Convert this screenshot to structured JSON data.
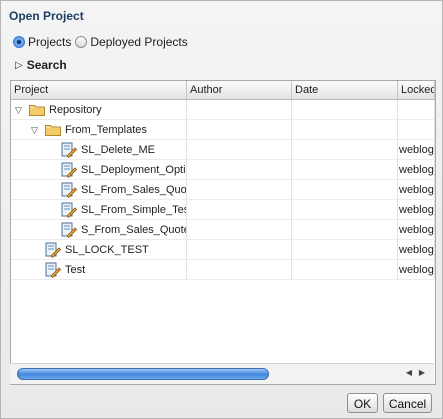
{
  "dialog": {
    "title": "Open Project"
  },
  "mode": {
    "options": [
      "Projects",
      "Deployed Projects"
    ],
    "selected": "Projects"
  },
  "search": {
    "label": "Search"
  },
  "table": {
    "columns": [
      "Project",
      "Author",
      "Date",
      "Locked"
    ],
    "rows": [
      {
        "name": "Repository",
        "type": "folder",
        "expanded": true,
        "author": "",
        "date": "",
        "locked": ""
      },
      {
        "name": "From_Templates",
        "type": "folder",
        "expanded": true,
        "author": "",
        "date": "",
        "locked": ""
      },
      {
        "name": "SL_Delete_ME",
        "type": "project",
        "author": "",
        "date": "",
        "locked": "weblog"
      },
      {
        "name": "SL_Deployment_Optic",
        "type": "project",
        "author": "",
        "date": "",
        "locked": "weblog"
      },
      {
        "name": "SL_From_Sales_Quot",
        "type": "project",
        "author": "",
        "date": "",
        "locked": "weblog"
      },
      {
        "name": "SL_From_Simple_Tes",
        "type": "project",
        "author": "",
        "date": "",
        "locked": "weblog"
      },
      {
        "name": "S_From_Sales_Quote",
        "type": "project",
        "author": "",
        "date": "",
        "locked": "weblog"
      },
      {
        "name": "SL_LOCK_TEST",
        "type": "project",
        "author": "",
        "date": "",
        "locked": "weblog"
      },
      {
        "name": "Test",
        "type": "project",
        "author": "",
        "date": "",
        "locked": "weblog"
      }
    ]
  },
  "scrollbar": {
    "horizontal_position": 0
  },
  "buttons": {
    "ok": "OK",
    "cancel": "Cancel"
  },
  "colors": {
    "accent": "#3f86dc",
    "title": "#1e3e63",
    "folder": "#f2d27a"
  },
  "icons": {
    "folder": "folder-icon",
    "project": "project-icon",
    "expand": "expand-triangle-icon"
  }
}
